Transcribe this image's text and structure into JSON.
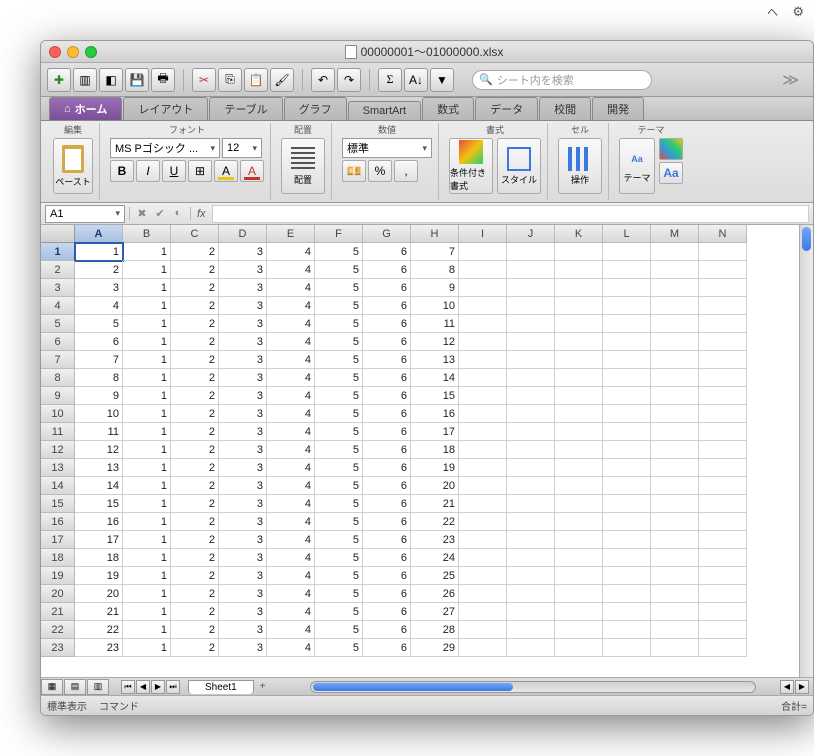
{
  "window": {
    "title": "00000001〜01000000.xlsx"
  },
  "search": {
    "placeholder": "シート内を検索"
  },
  "tabs": {
    "home": "ホーム",
    "layout": "レイアウト",
    "table": "テーブル",
    "chart": "グラフ",
    "smartart": "SmartArt",
    "formula": "数式",
    "data": "データ",
    "review": "校閲",
    "develop": "開発"
  },
  "groups": {
    "edit": "編集",
    "font": "フォント",
    "align": "配置",
    "number": "数値",
    "format": "書式",
    "cell": "セル",
    "theme": "テーマ"
  },
  "paste_label": "ペースト",
  "font_name": "MS Pゴシック ...",
  "font_size": "12",
  "number_format": "標準",
  "cond_fmt": "条件付き書式",
  "styles": "スタイル",
  "ops": "操作",
  "theme_btn": "テーマ",
  "aa": "Aa",
  "name_box": "A1",
  "fx": "fx",
  "columns": [
    "A",
    "B",
    "C",
    "D",
    "E",
    "F",
    "G",
    "H",
    "I",
    "J",
    "K",
    "L",
    "M",
    "N"
  ],
  "rows": [
    [
      1,
      1,
      2,
      3,
      4,
      5,
      6,
      7
    ],
    [
      2,
      1,
      2,
      3,
      4,
      5,
      6,
      8
    ],
    [
      3,
      1,
      2,
      3,
      4,
      5,
      6,
      9
    ],
    [
      4,
      1,
      2,
      3,
      4,
      5,
      6,
      10
    ],
    [
      5,
      1,
      2,
      3,
      4,
      5,
      6,
      11
    ],
    [
      6,
      1,
      2,
      3,
      4,
      5,
      6,
      12
    ],
    [
      7,
      1,
      2,
      3,
      4,
      5,
      6,
      13
    ],
    [
      8,
      1,
      2,
      3,
      4,
      5,
      6,
      14
    ],
    [
      9,
      1,
      2,
      3,
      4,
      5,
      6,
      15
    ],
    [
      10,
      1,
      2,
      3,
      4,
      5,
      6,
      16
    ],
    [
      11,
      1,
      2,
      3,
      4,
      5,
      6,
      17
    ],
    [
      12,
      1,
      2,
      3,
      4,
      5,
      6,
      18
    ],
    [
      13,
      1,
      2,
      3,
      4,
      5,
      6,
      19
    ],
    [
      14,
      1,
      2,
      3,
      4,
      5,
      6,
      20
    ],
    [
      15,
      1,
      2,
      3,
      4,
      5,
      6,
      21
    ],
    [
      16,
      1,
      2,
      3,
      4,
      5,
      6,
      22
    ],
    [
      17,
      1,
      2,
      3,
      4,
      5,
      6,
      23
    ],
    [
      18,
      1,
      2,
      3,
      4,
      5,
      6,
      24
    ],
    [
      19,
      1,
      2,
      3,
      4,
      5,
      6,
      25
    ],
    [
      20,
      1,
      2,
      3,
      4,
      5,
      6,
      26
    ],
    [
      21,
      1,
      2,
      3,
      4,
      5,
      6,
      27
    ],
    [
      22,
      1,
      2,
      3,
      4,
      5,
      6,
      28
    ],
    [
      23,
      1,
      2,
      3,
      4,
      5,
      6,
      29
    ]
  ],
  "selected_cell": "A1",
  "sheet_name": "Sheet1",
  "status": {
    "view": "標準表示",
    "command": "コマンド",
    "sum": "合計="
  }
}
